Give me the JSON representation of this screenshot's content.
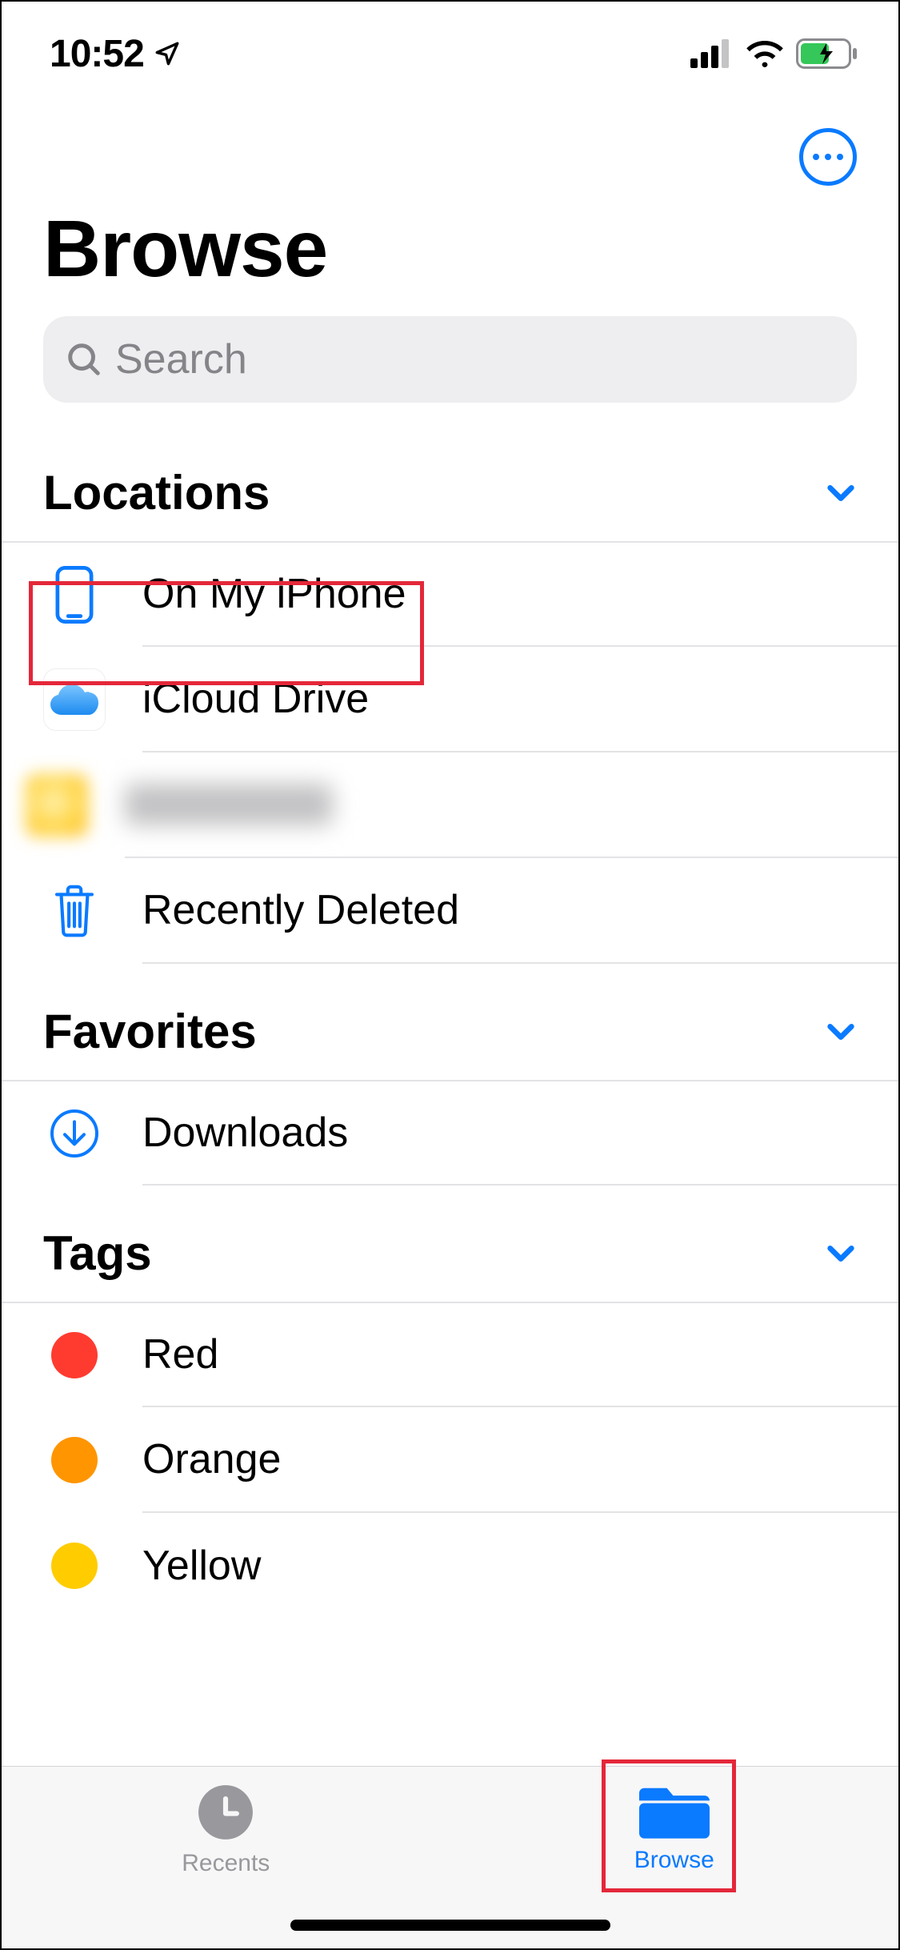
{
  "status": {
    "time": "10:52"
  },
  "nav": {
    "more_button": "more-options"
  },
  "page": {
    "title": "Browse"
  },
  "search": {
    "placeholder": "Search"
  },
  "sections": {
    "locations": {
      "label": "Locations",
      "items": [
        {
          "label": "On My iPhone",
          "icon": "iphone-icon"
        },
        {
          "label": "iCloud Drive",
          "icon": "cloud-icon"
        },
        {
          "label": "",
          "icon": "blurred-icon",
          "blurred": true
        },
        {
          "label": "Recently Deleted",
          "icon": "trash-icon"
        }
      ]
    },
    "favorites": {
      "label": "Favorites",
      "items": [
        {
          "label": "Downloads",
          "icon": "download-circle-icon"
        }
      ]
    },
    "tags": {
      "label": "Tags",
      "items": [
        {
          "label": "Red",
          "color": "#ff3b30"
        },
        {
          "label": "Orange",
          "color": "#ff9500"
        },
        {
          "label": "Yellow",
          "color": "#ffcc00"
        }
      ]
    }
  },
  "tabbar": {
    "items": [
      {
        "label": "Recents",
        "icon": "clock-icon",
        "active": false
      },
      {
        "label": "Browse",
        "icon": "folder-icon",
        "active": true
      }
    ]
  },
  "colors": {
    "accent": "#0a7aff"
  }
}
